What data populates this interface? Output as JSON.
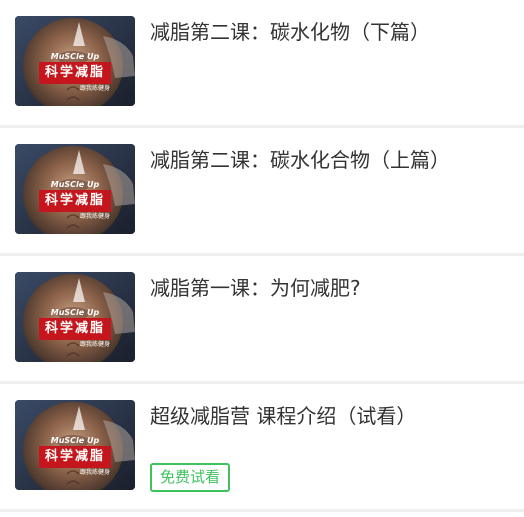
{
  "courses": [
    {
      "title": "减脂第二课：碳水化物（下篇）",
      "thumb": {
        "icon": "muscle-thumbnail-image",
        "brand": "MuSCle Up",
        "headline": "科学减脂",
        "sub": "跟我练健身"
      }
    },
    {
      "title": "减脂第二课：碳水化合物（上篇）",
      "thumb": {
        "icon": "muscle-thumbnail-image",
        "brand": "MuSCle Up",
        "headline": "科学减脂",
        "sub": "跟我练健身"
      }
    },
    {
      "title": "减脂第一课：为何减肥?",
      "thumb": {
        "icon": "muscle-thumbnail-image",
        "brand": "MuSCle Up",
        "headline": "科学减脂",
        "sub": "跟我练健身"
      }
    },
    {
      "title": "超级减脂营 课程介绍（试看）",
      "badge": "免费试看",
      "thumb": {
        "icon": "muscle-thumbnail-image",
        "brand": "MuSCle Up",
        "headline": "科学减脂",
        "sub": "跟我练健身"
      }
    }
  ],
  "colors": {
    "badge": "#3ec25e",
    "title_text": "#333333",
    "divider": "#eeeeee",
    "thumb_label_bg": "#c4161c"
  }
}
